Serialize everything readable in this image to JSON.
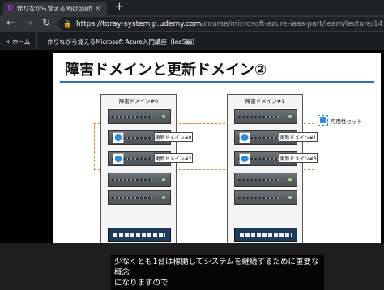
{
  "browser": {
    "tab_title": "作りながら覚えるMicrosoft Azure入門講座（IaaS編）",
    "tab_favicon": "udemy-logo-icon",
    "url_host": "https://toray-systemjp.udemy.com",
    "url_path": "/course/microsoft-azure-iaas-part/learn/lecture/14",
    "new_tab": "+",
    "close_glyph": "×",
    "back_glyph": "←",
    "forward_glyph": "→",
    "reload_glyph": "↻"
  },
  "udemy": {
    "home_label": "ホーム",
    "course_title": "作りながら覚えるMicrosoft Azure入門講座（IaaS編）"
  },
  "slide": {
    "title": "障害ドメインと更新ドメイン②",
    "racks": [
      {
        "label": "障害ドメイン#0",
        "vms": [
          "更新ドメイン#0",
          "更新ドメイン#2"
        ]
      },
      {
        "label": "障害ドメイン#1",
        "vms": [
          "更新ドメイン#1",
          "更新ドメイン#3"
        ]
      }
    ],
    "availability_set_label": "可用性セット",
    "accent_colors": {
      "title_rule": "#2b74b7",
      "availability_set": "#e0822e",
      "vm": "#2c8de0"
    }
  },
  "caption": {
    "line1": "少なくとも1台は稼働してシステムを継続するために重要な概念",
    "line2": "になりますので"
  }
}
